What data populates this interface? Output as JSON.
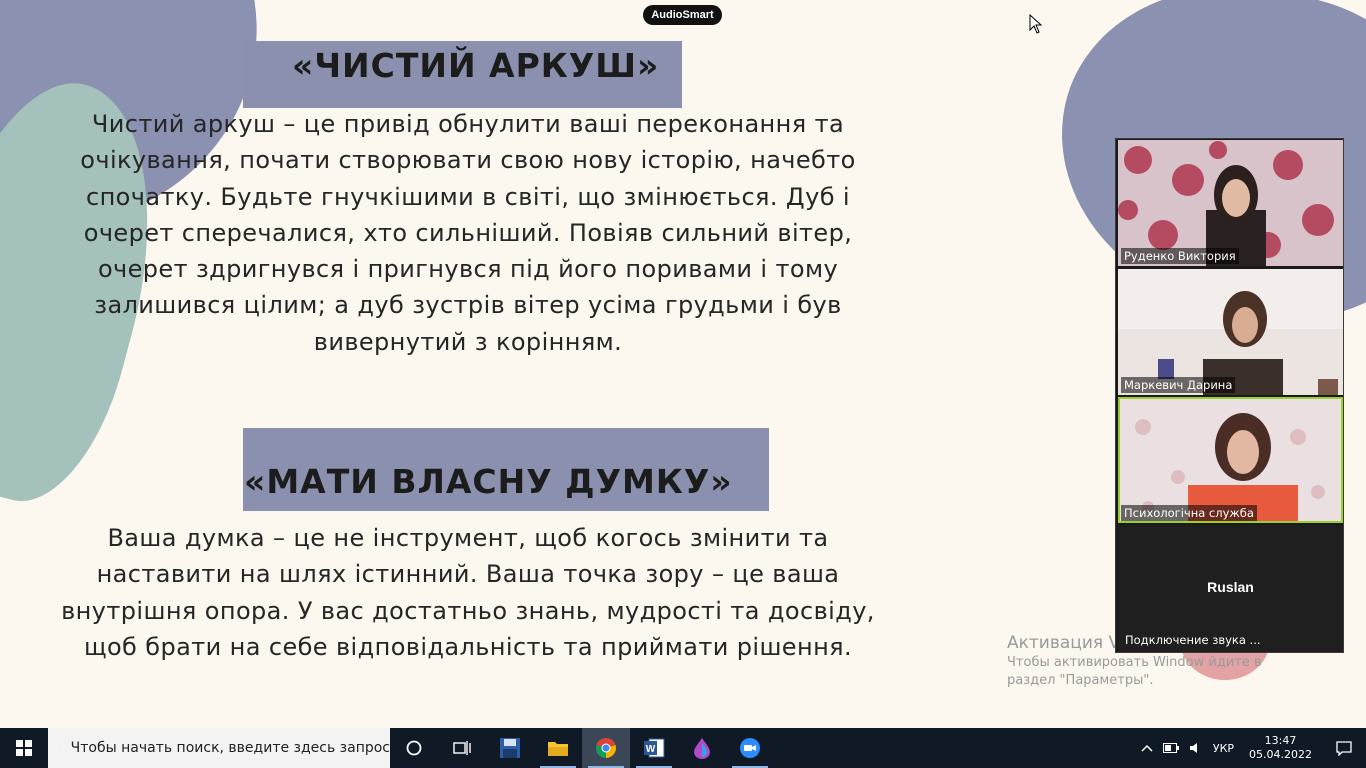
{
  "overlay": {
    "audiosmart_label": "AudioSmart"
  },
  "slide": {
    "heading1": "«ЧИСТИЙ АРКУШ»",
    "paragraph1": [
      "Чистий аркуш – це привід обнулити ваші переконання та",
      "очікування, почати створювати свою нову історію, начебто",
      "спочатку. Будьте гнучкішими в світі, що змінюється. Дуб і",
      "очерет сперечалися, хто сильніший. Повіяв сильний вітер,",
      "очерет здригнувся і пригнувся під його поривами і тому",
      "залишився цілим; а дуб зустрів вітер усіма грудьми і був",
      "вивернутий з корінням."
    ],
    "heading2": "«МАТИ ВЛАСНУ ДУМКУ»",
    "paragraph2": [
      "Ваша думка – це не інструмент, щоб когось змінити та",
      "наставити на шлях істинний. Ваша точка зору – це ваша",
      "внутрішня опора. У вас достатньо знань, мудрості та досвіду,",
      "щоб брати на себе відповідальність та приймати рішення."
    ],
    "colors": {
      "background": "#fdf8ef",
      "band": "#8a90ae",
      "blob_purple": "#8b91b0",
      "blob_teal": "#a4c1bc"
    }
  },
  "activation_watermark": {
    "title": "Активация V",
    "line1": "Чтобы активировать Window          йдите в",
    "line2": "раздел \"Параметры\"."
  },
  "video_panel": {
    "participants": [
      {
        "name": "Руденко  Виктория"
      },
      {
        "name": "Маркевич Дарина"
      },
      {
        "name": "Психологічна служба",
        "active_speaker": true
      },
      {
        "name": "Ruslan",
        "status": "Подключение звука ..."
      }
    ],
    "active_speaker_color": "#9ad032"
  },
  "taskbar": {
    "search_placeholder": "Чтобы начать поиск, введите здесь запрос",
    "apps": [
      "task-view",
      "file-explorer-save",
      "folder",
      "chrome",
      "word",
      "paint",
      "zoom"
    ],
    "language": "УКР",
    "time": "13:47",
    "date": "05.04.2022"
  }
}
